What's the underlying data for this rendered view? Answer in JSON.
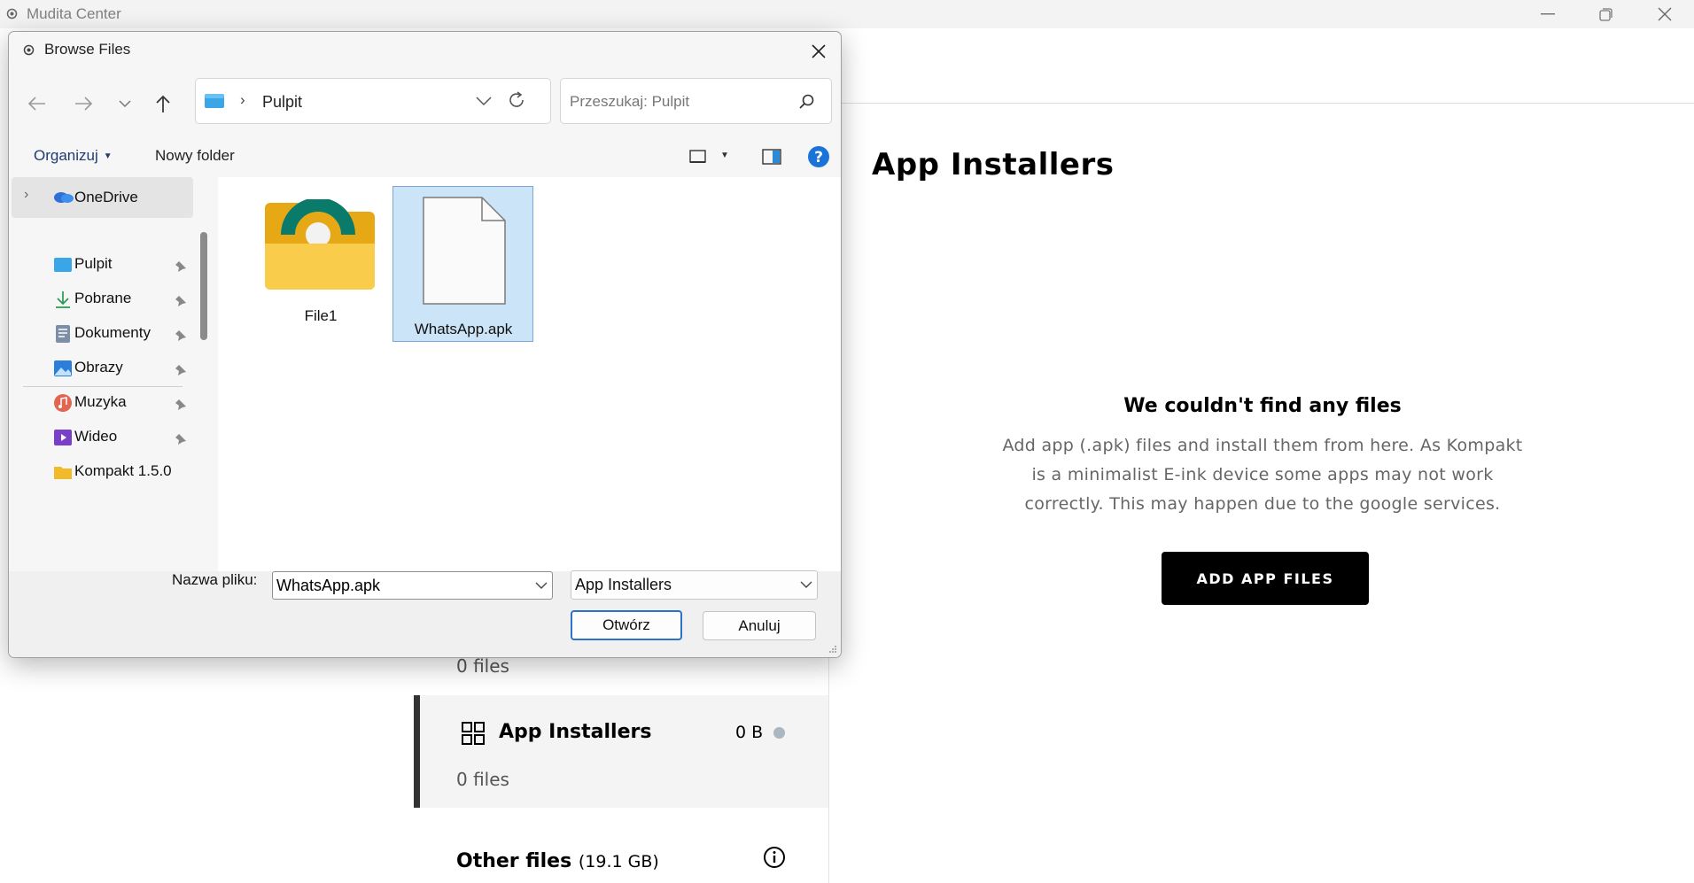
{
  "app": {
    "title": "Mudita Center",
    "content_title": "App Installers",
    "empty_title": "We couldn't find any files",
    "empty_desc": "Add app (.apk) files and install them from here. As Kompakt is a minimalist E-ink device some apps may not work correctly. This may happen due to the google services.",
    "add_button": "ADD APP FILES",
    "panel": {
      "row1_count": "0 files",
      "app_installers_label": "App Installers",
      "app_installers_size": "0 B",
      "app_installers_count": "0 files",
      "other_label": "Other files",
      "other_size": "(19.1 GB)"
    }
  },
  "dialog": {
    "title": "Browse Files",
    "address": "Pulpit",
    "search_placeholder": "Przeszukaj: Pulpit",
    "toolbar": {
      "organize": "Organizuj",
      "new_folder": "Nowy folder"
    },
    "nav": {
      "onedrive": "OneDrive",
      "items": [
        "Pulpit",
        "Pobrane",
        "Dokumenty",
        "Obrazy",
        "Muzyka",
        "Wideo",
        "Kompakt 1.5.0"
      ]
    },
    "files": [
      {
        "name": "File1",
        "type": "folder",
        "selected": false
      },
      {
        "name": "WhatsApp.apk",
        "type": "file",
        "selected": true
      }
    ],
    "file_name_label": "Nazwa pliku:",
    "file_name_value": "WhatsApp.apk",
    "filter": "App Installers",
    "open_button": "Otwórz",
    "cancel_button": "Anuluj"
  },
  "icons": [
    "app-logo-icon",
    "minimize-icon",
    "maximize-icon",
    "close-icon",
    "back-arrow-icon",
    "forward-arrow-icon",
    "recent-chevron-icon",
    "up-arrow-icon",
    "desktop-folder-icon",
    "refresh-icon",
    "search-icon",
    "view-icon",
    "preview-pane-icon",
    "help-icon",
    "onedrive-icon",
    "download-icon",
    "documents-icon",
    "pictures-icon",
    "music-icon",
    "video-icon",
    "folder-icon",
    "pin-icon",
    "grid-icon",
    "info-icon",
    "file-icon"
  ],
  "colors": {
    "accent": "#2a73c8",
    "selection": "#cce4f7",
    "button_dark": "#000000",
    "dot": "#aab6c2"
  }
}
